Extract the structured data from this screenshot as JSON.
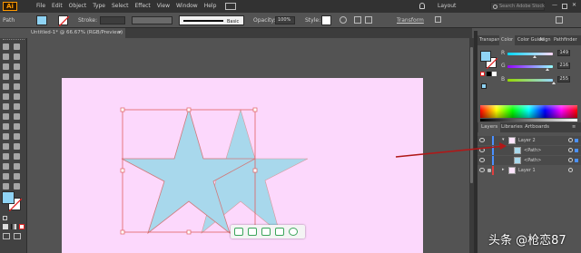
{
  "app": {
    "logo": "Ai",
    "menus": [
      "File",
      "Edit",
      "Object",
      "Type",
      "Select",
      "Effect",
      "View",
      "Window",
      "Help"
    ],
    "workspace": "Layout",
    "search_placeholder": "Search Adobe Stock"
  },
  "control_bar": {
    "selection_type": "Path",
    "stroke_label": "Stroke:",
    "brush_label": "Basic",
    "opacity_label": "Opacity:",
    "opacity_value": "100%",
    "style_label": "Style:",
    "transform_label": "Transform",
    "fill_color": "#8fd3f4"
  },
  "document": {
    "tab_title": "Untitled-1* @ 66.67% (RGB/Preview)",
    "artboard_color": "#fcd8fc",
    "star_color": "#a8d8ec"
  },
  "color_panel": {
    "tabs": [
      "Transparency",
      "Color",
      "Color Guide",
      "Align",
      "Pathfinder"
    ],
    "active_tab": "Color",
    "channels": [
      {
        "label": "R",
        "value": "149"
      },
      {
        "label": "G",
        "value": "216"
      },
      {
        "label": "B",
        "value": "255"
      }
    ]
  },
  "layers_panel": {
    "tabs": [
      "Layers",
      "Libraries",
      "Artboards"
    ],
    "active_tab": "Layers",
    "rows": [
      {
        "name": "Layer 2",
        "indent": 0,
        "selected": true,
        "expanded": true
      },
      {
        "name": "<Path>",
        "indent": 1,
        "selected": true
      },
      {
        "name": "<Path>",
        "indent": 1,
        "selected": true
      },
      {
        "name": "Layer 1",
        "indent": 0,
        "selected": false,
        "expanded": false
      }
    ]
  },
  "watermark": "头条 @枪恋87"
}
